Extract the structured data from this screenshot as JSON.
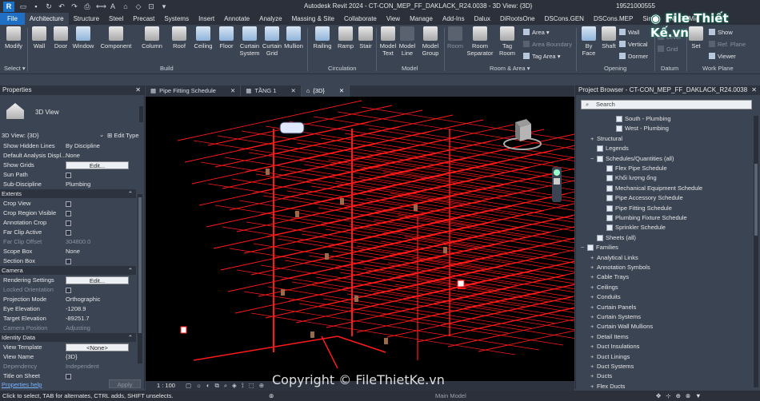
{
  "title": "Autodesk Revit 2024 - CT-CON_MEP_FF_DAKLACK_R24.0038 - 3D View: {3D}",
  "user": "19521000555",
  "logo_text": "File Thiết Kế.vn",
  "watermark": "Copyright © FileThietKe.vn",
  "tabs": [
    "File",
    "Architecture",
    "Structure",
    "Steel",
    "Precast",
    "Systems",
    "Insert",
    "Annotate",
    "Analyze",
    "Massing & Site",
    "Collaborate",
    "View",
    "Manage",
    "Add-Ins",
    "Dalux",
    "DiRootsOne",
    "DSCons.GEN",
    "DSCons.MEP",
    "SiruS",
    "[N] LT (Mic"
  ],
  "ribbon": {
    "modify": "Modify",
    "select": "Select ▾",
    "wall": "Wall",
    "door": "Door",
    "window": "Window",
    "component": "Component",
    "column": "Column",
    "roof": "Roof",
    "ceiling": "Ceiling",
    "floor": "Floor",
    "curtain_system": "Curtain System",
    "curtain_grid": "Curtain Grid",
    "mullion": "Mullion",
    "railing": "Railing",
    "ramp": "Ramp",
    "stair": "Stair",
    "model_text": "Model Text",
    "model_line": "Model Line",
    "model_group": "Model Group",
    "room": "Room",
    "room_separator": "Room Separator",
    "tag_room": "Tag Room",
    "area": "Area ▾",
    "area_boundary": "Area Boundary",
    "tag_area": "Tag Area ▾",
    "by_face": "By Face",
    "shaft": "Shaft",
    "wall_op": "Wall",
    "vertical": "Vertical",
    "dormer": "Dormer",
    "level": "Level",
    "grid": "Grid",
    "set": "Set",
    "show": "Show",
    "ref_plane": "Ref. Plane",
    "viewer": "Viewer",
    "panels": {
      "build": "Build",
      "circulation": "Circulation",
      "model": "Model",
      "room_area": "Room & Area ▾",
      "opening": "Opening",
      "datum": "Datum",
      "work_plane": "Work Plane"
    }
  },
  "properties": {
    "header": "Properties",
    "type": "3D View",
    "type_selector": "3D View: {3D}",
    "edit_type": "Edit Type",
    "rows": [
      {
        "k": "Show Hidden Lines",
        "v": "By Discipline"
      },
      {
        "k": "Default Analysis Displ...",
        "v": "None"
      },
      {
        "k": "Show Grids",
        "btn": "Edit..."
      },
      {
        "k": "Sun Path",
        "cb": true
      },
      {
        "k": "Sub-Discipline",
        "v": "Plumbing"
      }
    ],
    "sections": {
      "extents": "Extents",
      "camera": "Camera",
      "identity": "Identity Data"
    },
    "extents": [
      {
        "k": "Crop View"
      },
      {
        "k": "Crop Region Visible"
      },
      {
        "k": "Annotation Crop"
      },
      {
        "k": "Far Clip Active"
      },
      {
        "k": "Far Clip Offset",
        "v": "304800.0",
        "dim": true
      },
      {
        "k": "Scope Box",
        "v": "None"
      },
      {
        "k": "Section Box"
      }
    ],
    "camera": [
      {
        "k": "Rendering Settings",
        "btn": "Edit..."
      },
      {
        "k": "Locked Orientation",
        "dim": true
      },
      {
        "k": "Projection Mode",
        "v": "Orthographic"
      },
      {
        "k": "Eye Elevation",
        "v": "-1208.9"
      },
      {
        "k": "Target Elevation",
        "v": "-89251.7"
      },
      {
        "k": "Camera Position",
        "v": "Adjusting",
        "dim": true
      }
    ],
    "identity": [
      {
        "k": "View Template",
        "btn": "<None>"
      },
      {
        "k": "View Name",
        "v": "{3D}"
      },
      {
        "k": "Dependency",
        "v": "Independent",
        "dim": true
      },
      {
        "k": "Title on Sheet"
      }
    ],
    "help": "Properties help",
    "apply": "Apply"
  },
  "view_tabs": [
    "Pipe Fitting Schedule",
    "TẦNG 1",
    "{3D}"
  ],
  "viewport": {
    "scale": "1 : 100",
    "bg": "#000000",
    "pipe_color": "#ff1a1a"
  },
  "browser": {
    "header": "Project Browser - CT-CON_MEP_FF_DAKLACK_R24.0038",
    "search": "Search",
    "items": [
      {
        "t": "South - Plumbing",
        "lv": 3,
        "sq": true
      },
      {
        "t": "West - Plumbing",
        "lv": 3,
        "sq": true
      },
      {
        "t": "Structural",
        "lv": 1,
        "exp": "+"
      },
      {
        "t": "Legends",
        "lv": 1,
        "sq": true
      },
      {
        "t": "Schedules/Quantities (all)",
        "lv": 1,
        "exp": "−",
        "sq": true
      },
      {
        "t": "Flex Pipe Schedule",
        "lv": 2,
        "sq": true
      },
      {
        "t": "Khối lượng ống",
        "lv": 2,
        "sq": true
      },
      {
        "t": "Mechanical Equipment Schedule",
        "lv": 2,
        "sq": true
      },
      {
        "t": "Pipe Accessory Schedule",
        "lv": 2,
        "sq": true
      },
      {
        "t": "Pipe Fitting Schedule",
        "lv": 2,
        "sq": true
      },
      {
        "t": "Plumbing Fixture Schedule",
        "lv": 2,
        "sq": true
      },
      {
        "t": "Sprinkler Schedule",
        "lv": 2,
        "sq": true
      },
      {
        "t": "Sheets (all)",
        "lv": 1,
        "sq": true
      },
      {
        "t": "Families",
        "lv": 0,
        "exp": "−",
        "sq": true
      },
      {
        "t": "Analytical Links",
        "lv": 1,
        "exp": "+"
      },
      {
        "t": "Annotation Symbols",
        "lv": 1,
        "exp": "+"
      },
      {
        "t": "Cable Trays",
        "lv": 1,
        "exp": "+"
      },
      {
        "t": "Ceilings",
        "lv": 1,
        "exp": "+"
      },
      {
        "t": "Conduits",
        "lv": 1,
        "exp": "+"
      },
      {
        "t": "Curtain Panels",
        "lv": 1,
        "exp": "+"
      },
      {
        "t": "Curtain Systems",
        "lv": 1,
        "exp": "+"
      },
      {
        "t": "Curtain Wall Mullions",
        "lv": 1,
        "exp": "+"
      },
      {
        "t": "Detail Items",
        "lv": 1,
        "exp": "+"
      },
      {
        "t": "Duct Insulations",
        "lv": 1,
        "exp": "+"
      },
      {
        "t": "Duct Linings",
        "lv": 1,
        "exp": "+"
      },
      {
        "t": "Duct Systems",
        "lv": 1,
        "exp": "+"
      },
      {
        "t": "Ducts",
        "lv": 1,
        "exp": "+"
      },
      {
        "t": "Flex Ducts",
        "lv": 1,
        "exp": "+"
      }
    ]
  },
  "status": {
    "hint": "Click to select, TAB for alternates, CTRL adds, SHIFT unselects.",
    "model": "Main Model"
  }
}
